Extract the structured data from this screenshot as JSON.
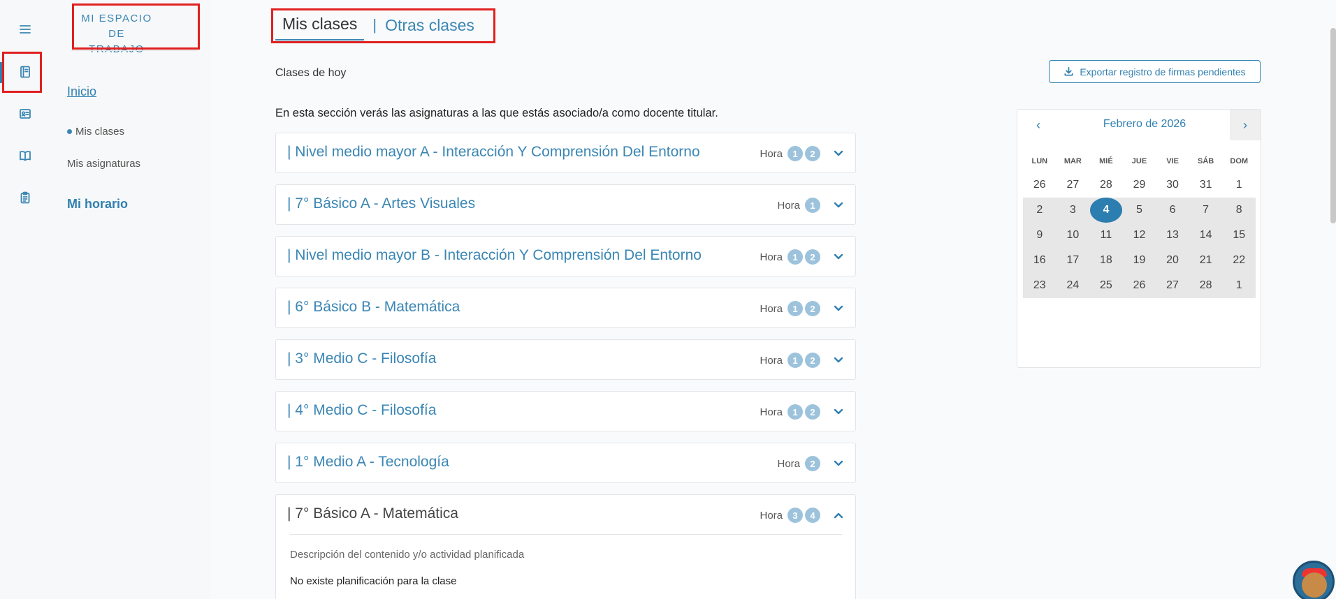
{
  "sidebar": {
    "title_line1": "MI ESPACIO DE",
    "title_line2": "TRABAJO",
    "inicio": "Inicio",
    "mis_clases": "Mis clases",
    "mis_asignaturas": "Mis asignaturas",
    "mi_horario": "Mi horario"
  },
  "rail_icons": [
    "menu-icon",
    "notebook-icon",
    "id-card-icon",
    "book-open-icon",
    "clipboard-icon"
  ],
  "tabs": {
    "mine": "Mis clases",
    "separator": "|",
    "other": "Otras clases"
  },
  "header": {
    "today": "Clases de hoy",
    "export": "Exportar registro de firmas pendientes",
    "intro": "En esta sección verás las asignaturas a las que estás asociado/a como docente titular."
  },
  "hora_label": "Hora",
  "classes": [
    {
      "title": "| Nivel medio mayor A - Interacción Y Comprensión Del Entorno",
      "hours": [
        "1",
        "2"
      ]
    },
    {
      "title": "| 7° Básico A - Artes Visuales",
      "hours": [
        "1"
      ]
    },
    {
      "title": "| Nivel medio mayor B - Interacción Y Comprensión Del Entorno",
      "hours": [
        "1",
        "2"
      ]
    },
    {
      "title": "| 6° Básico B - Matemática",
      "hours": [
        "1",
        "2"
      ]
    },
    {
      "title": "| 3° Medio C - Filosofía",
      "hours": [
        "1",
        "2"
      ]
    },
    {
      "title": "| 4° Medio C - Filosofía",
      "hours": [
        "1",
        "2"
      ]
    },
    {
      "title": "| 1° Medio A - Tecnología",
      "hours": [
        "2"
      ]
    },
    {
      "title": "| 7° Básico A - Matemática",
      "hours": [
        "3",
        "4"
      ],
      "expanded": true
    }
  ],
  "expanded_detail": {
    "description_label": "Descripción del contenido y/o actividad planificada",
    "no_plan": "No existe planificación para la clase"
  },
  "calendar": {
    "prev": "‹",
    "next": "›",
    "month": "Febrero de 2026",
    "weekdays": [
      "LUN",
      "MAR",
      "MIÉ",
      "JUE",
      "VIE",
      "SÁB",
      "DOM"
    ],
    "days": [
      "26",
      "27",
      "28",
      "29",
      "30",
      "31",
      "1",
      "2",
      "3",
      "4",
      "5",
      "6",
      "7",
      "8",
      "9",
      "10",
      "11",
      "12",
      "13",
      "14",
      "15",
      "16",
      "17",
      "18",
      "19",
      "20",
      "21",
      "22",
      "23",
      "24",
      "25",
      "26",
      "27",
      "28",
      "1"
    ],
    "today": "4"
  },
  "colors": {
    "accent": "#2f7fb0",
    "badge": "#9dc3dc",
    "highlight_box": "#e02020"
  }
}
